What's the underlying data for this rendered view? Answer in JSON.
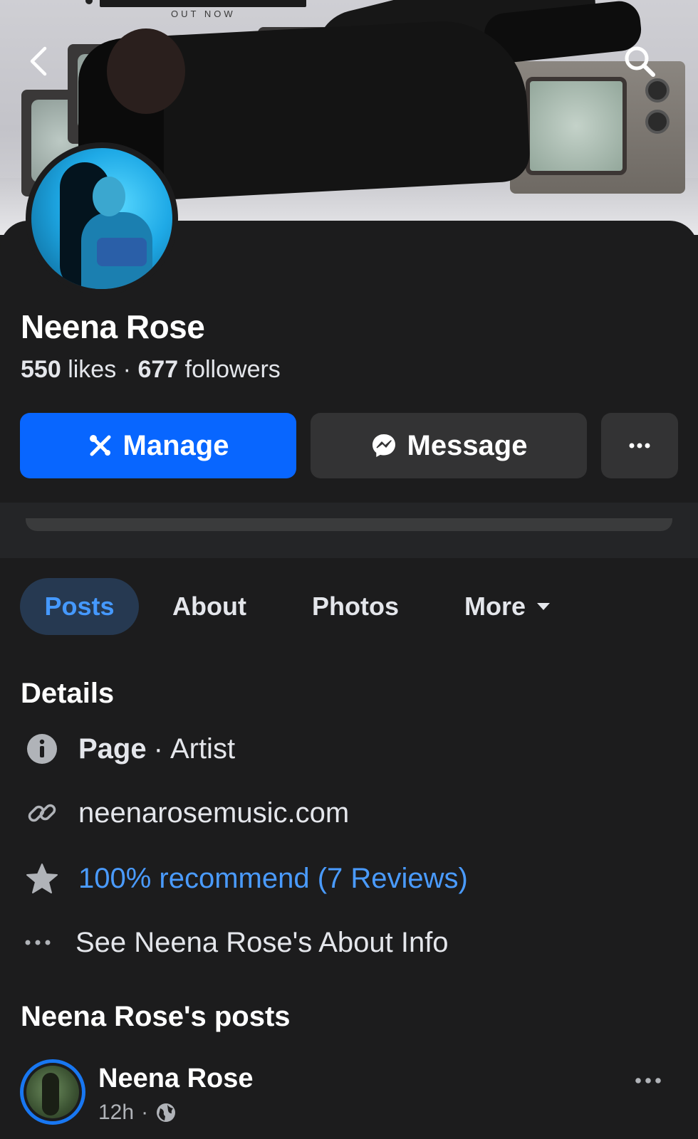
{
  "cover": {
    "caption": "OUT NOW"
  },
  "profile": {
    "name": "Neena Rose",
    "likes_count": "550",
    "likes_label": "likes",
    "separator": "·",
    "followers_count": "677",
    "followers_label": "followers"
  },
  "actions": {
    "manage_label": "Manage",
    "message_label": "Message",
    "more_label": "···"
  },
  "tabs": [
    {
      "label": "Posts",
      "active": true
    },
    {
      "label": "About",
      "active": false
    },
    {
      "label": "Photos",
      "active": false
    },
    {
      "label": "More",
      "active": false
    }
  ],
  "details": {
    "title": "Details",
    "page_label": "Page",
    "page_separator": "·",
    "page_category": "Artist",
    "website": "neenarosemusic.com",
    "recommend_text": "100% recommend (7 Reviews)",
    "about_link": "See Neena Rose's About Info"
  },
  "posts": {
    "title": "Neena Rose's posts",
    "first_post": {
      "author": "Neena Rose",
      "time": "12h",
      "separator": "·",
      "audience_icon": "globe-icon"
    }
  },
  "colors": {
    "background": "#1c1c1d",
    "primary": "#0866ff",
    "secondary_button": "#333334",
    "active_tab_bg": "#263951",
    "active_tab_text": "#4599ff",
    "link": "#4a9bff"
  }
}
